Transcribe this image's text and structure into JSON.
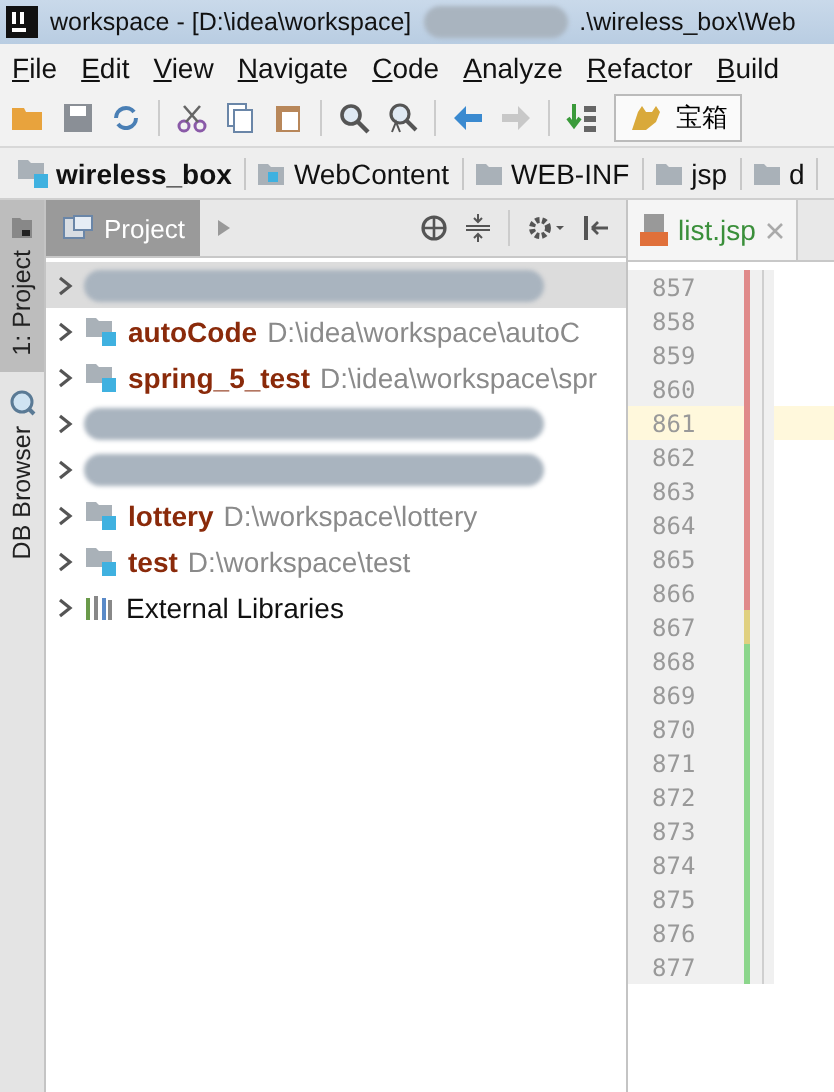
{
  "window": {
    "title": "workspace - [D:\\idea\\workspace]",
    "title_tail": ".\\wireless_box\\Web"
  },
  "menu": [
    {
      "label": "File"
    },
    {
      "label": "Edit"
    },
    {
      "label": "View"
    },
    {
      "label": "Navigate"
    },
    {
      "label": "Code"
    },
    {
      "label": "Analyze"
    },
    {
      "label": "Refactor"
    },
    {
      "label": "Build"
    }
  ],
  "toolbar": {
    "run_config": "宝箱"
  },
  "breadcrumbs": [
    {
      "label": "wireless_box",
      "kind": "module"
    },
    {
      "label": "WebContent",
      "kind": "web"
    },
    {
      "label": "WEB-INF",
      "kind": "folder"
    },
    {
      "label": "jsp",
      "kind": "folder"
    },
    {
      "label": "d",
      "kind": "folder"
    }
  ],
  "side_tabs": [
    {
      "label": "1: Project",
      "selected": true
    },
    {
      "label": "DB Browser",
      "selected": false
    }
  ],
  "project_panel": {
    "title": "Project",
    "tree": [
      {
        "kind": "redacted",
        "expanded": false
      },
      {
        "kind": "module",
        "name": "autoCode",
        "path": "D:\\idea\\workspace\\autoC",
        "expanded": false
      },
      {
        "kind": "module",
        "name": "spring_5_test",
        "path": "D:\\idea\\workspace\\spr",
        "expanded": false
      },
      {
        "kind": "redacted",
        "expanded": false
      },
      {
        "kind": "redacted",
        "expanded": false
      },
      {
        "kind": "module",
        "name": "lottery",
        "path": "D:\\workspace\\lottery",
        "expanded": false
      },
      {
        "kind": "module",
        "name": "test",
        "path": "D:\\workspace\\test",
        "expanded": false
      },
      {
        "kind": "libraries",
        "name": "External Libraries",
        "expanded": false
      }
    ]
  },
  "editor": {
    "tab": {
      "label": "list.jsp",
      "selected": true
    },
    "lines": [
      {
        "number": "857",
        "color": "#e08a8a",
        "current": false
      },
      {
        "number": "858",
        "color": "#e08a8a",
        "current": false
      },
      {
        "number": "859",
        "color": "#e08a8a",
        "current": false
      },
      {
        "number": "860",
        "color": "#e08a8a",
        "current": false
      },
      {
        "number": "861",
        "color": "#e08a8a",
        "current": true
      },
      {
        "number": "862",
        "color": "#e08a8a",
        "current": false
      },
      {
        "number": "863",
        "color": "#e08a8a",
        "current": false
      },
      {
        "number": "864",
        "color": "#e08a8a",
        "current": false
      },
      {
        "number": "865",
        "color": "#e08a8a",
        "current": false
      },
      {
        "number": "866",
        "color": "#e08a8a",
        "current": false
      },
      {
        "number": "867",
        "color": "#e0d080",
        "current": false
      },
      {
        "number": "868",
        "color": "#8cd68c",
        "current": false
      },
      {
        "number": "869",
        "color": "#8cd68c",
        "current": false
      },
      {
        "number": "870",
        "color": "#8cd68c",
        "current": false
      },
      {
        "number": "871",
        "color": "#8cd68c",
        "current": false
      },
      {
        "number": "872",
        "color": "#8cd68c",
        "current": false
      },
      {
        "number": "873",
        "color": "#8cd68c",
        "current": false
      },
      {
        "number": "874",
        "color": "#8cd68c",
        "current": false
      },
      {
        "number": "875",
        "color": "#8cd68c",
        "current": false
      },
      {
        "number": "876",
        "color": "#8cd68c",
        "current": false
      },
      {
        "number": "877",
        "color": "#8cd68c",
        "current": false
      }
    ]
  }
}
